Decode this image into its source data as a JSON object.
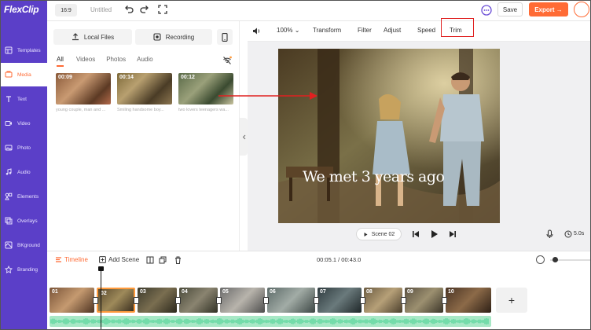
{
  "app": {
    "name": "FlexClip"
  },
  "topbar": {
    "ratio": "16:9",
    "title": "Untitled",
    "save_label": "Save",
    "export_label": "Export →"
  },
  "sidebar": {
    "items": [
      {
        "label": "Templates",
        "icon": "templates-icon"
      },
      {
        "label": "Media",
        "icon": "media-icon"
      },
      {
        "label": "Text",
        "icon": "text-icon"
      },
      {
        "label": "Video",
        "icon": "video-icon"
      },
      {
        "label": "Photo",
        "icon": "photo-icon"
      },
      {
        "label": "Audio",
        "icon": "audio-icon"
      },
      {
        "label": "Elements",
        "icon": "elements-icon"
      },
      {
        "label": "Overlays",
        "icon": "overlays-icon"
      },
      {
        "label": "BKground",
        "icon": "background-icon"
      },
      {
        "label": "Branding",
        "icon": "branding-icon"
      }
    ],
    "active_index": 1
  },
  "media": {
    "local_files_label": "Local Files",
    "recording_label": "Recording",
    "tabs": [
      "All",
      "Videos",
      "Photos",
      "Audio"
    ],
    "active_tab": 0,
    "thumbs": [
      {
        "duration": "00:09",
        "caption": "young couple, man and ..."
      },
      {
        "duration": "00:14",
        "caption": "Smiling handsome boy..."
      },
      {
        "duration": "00:12",
        "caption": "two lovers teenagers wa..."
      }
    ]
  },
  "toolbar": {
    "zoom": "100%",
    "tools": [
      "Transform",
      "Filter",
      "Adjust",
      "Speed",
      "Trim"
    ]
  },
  "preview": {
    "caption": "We met 3 years ago",
    "scene_label": "Scene 02",
    "duration": "5.0s"
  },
  "timeline": {
    "label": "Timeline",
    "add_scene_label": "Add Scene",
    "time": "00:05.1 / 00:43.0",
    "clips": [
      "01",
      "02",
      "03",
      "04",
      "05",
      "06",
      "07",
      "08",
      "09",
      "10"
    ],
    "selected_clip": 1,
    "add_label": "+"
  },
  "colors": {
    "sidebar": "#5b3fc8",
    "accent": "#ff6b35",
    "annotation": "#e02020",
    "audio_wave": "#3fcf8e"
  }
}
